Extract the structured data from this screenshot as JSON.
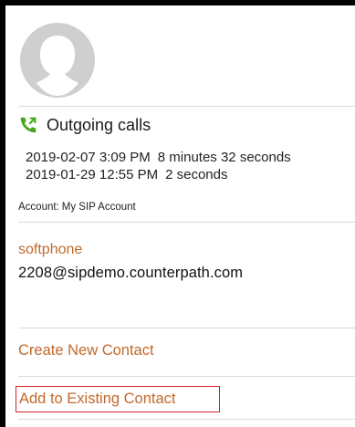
{
  "calls": {
    "title": "Outgoing calls",
    "entries": [
      {
        "datetime": "2019-02-07 3:09 PM",
        "duration": "8 minutes 32 seconds"
      },
      {
        "datetime": "2019-01-29 12:55 PM",
        "duration": "2 seconds"
      }
    ]
  },
  "account": {
    "label": "Account:",
    "name": "My SIP Account"
  },
  "contact_info": {
    "label": "softphone",
    "value": "2208@sipdemo.counterpath.com"
  },
  "actions": {
    "create": "Create New Contact",
    "add_existing": "Add to Existing Contact"
  },
  "colors": {
    "accent": "#c06a2c",
    "call_icon": "#4aa61f",
    "highlight": "#d6202a",
    "avatar": "#cfcfcf"
  },
  "icons": {
    "avatar": "person-placeholder-icon",
    "call": "outgoing-call-icon"
  }
}
